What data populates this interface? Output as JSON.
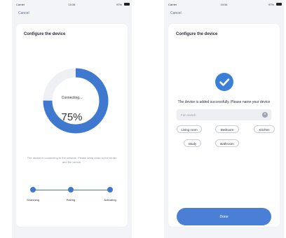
{
  "colors": {
    "accent": "#3f78cf",
    "card_bg": "#ffffff",
    "screen_bg": "#f3f4f8",
    "ring_track": "#eef0f4"
  },
  "left_screen": {
    "status": {
      "carrier": "Carrier",
      "time": "10:34",
      "battery": "97%"
    },
    "cancel_label": "Cancel",
    "title": "Configure the device",
    "progress": {
      "label": "Connecting...",
      "percent_text": "75%",
      "value": 0.75
    },
    "hint": "The device is connecting to the network. Please keep close to the router and the device.",
    "steps": [
      {
        "label": "Searching"
      },
      {
        "label": "Pairing"
      },
      {
        "label": "Activating"
      }
    ]
  },
  "right_screen": {
    "status": {
      "carrier": "Carrier",
      "time": "10:34",
      "battery": "97%"
    },
    "cancel_label": "Cancel",
    "title": "Configure the device",
    "success_message": "The device is added successfully. Please name your device",
    "name_input": {
      "value": "",
      "placeholder": "Fan switch"
    },
    "room_chips": [
      "Living room",
      "Bedroom",
      "Kitchen",
      "Study",
      "Bathroom"
    ],
    "done_label": "Done"
  }
}
